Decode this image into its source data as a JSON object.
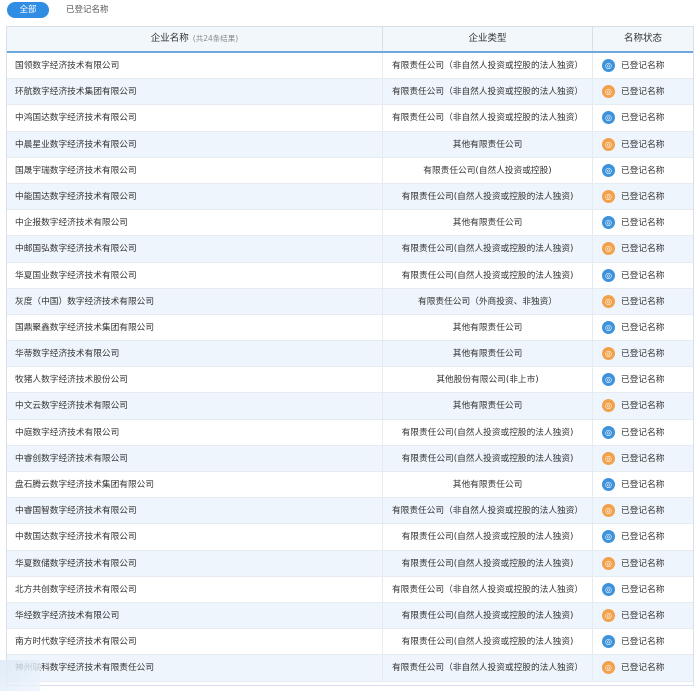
{
  "filter": {
    "tab_all": "全部",
    "tab_registered": "已登记名称"
  },
  "table": {
    "header": {
      "name": "企业名称",
      "count_note": "(共24条结果)",
      "type": "企业类型",
      "status": "名称状态"
    },
    "rows": [
      {
        "name": "国领数字经济技术有限公司",
        "type": "有限责任公司（非自然人投资或控股的法人独资）",
        "status": "已登记名称",
        "icon": "blue"
      },
      {
        "name": "环航数字经济技术集团有限公司",
        "type": "有限责任公司（非自然人投资或控股的法人独资）",
        "status": "已登记名称",
        "icon": "orange"
      },
      {
        "name": "中鸿国达数字经济技术有限公司",
        "type": "有限责任公司（非自然人投资或控股的法人独资）",
        "status": "已登记名称",
        "icon": "blue"
      },
      {
        "name": "中晨星业数字经济技术有限公司",
        "type": "其他有限责任公司",
        "status": "已登记名称",
        "icon": "orange"
      },
      {
        "name": "国晟宇瑞数字经济技术有限公司",
        "type": "有限责任公司(自然人投资或控股)",
        "status": "已登记名称",
        "icon": "blue"
      },
      {
        "name": "中能国达数字经济技术有限公司",
        "type": "有限责任公司(自然人投资或控股的法人独资)",
        "status": "已登记名称",
        "icon": "orange"
      },
      {
        "name": "中企报数字经济技术有限公司",
        "type": "其他有限责任公司",
        "status": "已登记名称",
        "icon": "blue"
      },
      {
        "name": "中邮国弘数字经济技术有限公司",
        "type": "有限责任公司(自然人投资或控股的法人独资)",
        "status": "已登记名称",
        "icon": "orange"
      },
      {
        "name": "华夏国业数字经济技术有限公司",
        "type": "有限责任公司(自然人投资或控股的法人独资)",
        "status": "已登记名称",
        "icon": "blue"
      },
      {
        "name": "灰度（中国）数字经济技术有限公司",
        "type": "有限责任公司（外商投资、非独资）",
        "status": "已登记名称",
        "icon": "orange"
      },
      {
        "name": "国鼎聚鑫数字经济技术集团有限公司",
        "type": "其他有限责任公司",
        "status": "已登记名称",
        "icon": "blue"
      },
      {
        "name": "华蒂数字经济技术有限公司",
        "type": "其他有限责任公司",
        "status": "已登记名称",
        "icon": "orange"
      },
      {
        "name": "牧猪人数字经济技术股份公司",
        "type": "其他股份有限公司(非上市)",
        "status": "已登记名称",
        "icon": "blue"
      },
      {
        "name": "中文云数字经济技术有限公司",
        "type": "其他有限责任公司",
        "status": "已登记名称",
        "icon": "orange"
      },
      {
        "name": "中庭数字经济技术有限公司",
        "type": "有限责任公司(自然人投资或控股的法人独资)",
        "status": "已登记名称",
        "icon": "blue"
      },
      {
        "name": "中睿创数字经济技术有限公司",
        "type": "有限责任公司(自然人投资或控股的法人独资)",
        "status": "已登记名称",
        "icon": "orange"
      },
      {
        "name": "盘石腾云数字经济技术集团有限公司",
        "type": "其他有限责任公司",
        "status": "已登记名称",
        "icon": "blue"
      },
      {
        "name": "中睿国智数字经济技术有限公司",
        "type": "有限责任公司（非自然人投资或控股的法人独资）",
        "status": "已登记名称",
        "icon": "orange"
      },
      {
        "name": "中数国达数字经济技术有限公司",
        "type": "有限责任公司(自然人投资或控股的法人独资)",
        "status": "已登记名称",
        "icon": "blue"
      },
      {
        "name": "华夏数储数字经济技术有限公司",
        "type": "有限责任公司(自然人投资或控股的法人独资)",
        "status": "已登记名称",
        "icon": "orange"
      },
      {
        "name": "北方共创数字经济技术有限公司",
        "type": "有限责任公司（非自然人投资或控股的法人独资）",
        "status": "已登记名称",
        "icon": "blue"
      },
      {
        "name": "华经数字经济技术有限公司",
        "type": "有限责任公司(自然人投资或控股的法人独资)",
        "status": "已登记名称",
        "icon": "orange"
      },
      {
        "name": "南方时代数字经济技术有限公司",
        "type": "有限责任公司(自然人投资或控股的法人独资)",
        "status": "已登记名称",
        "icon": "blue"
      },
      {
        "name": "神州联科数字经济技术有限责任公司",
        "type": "有限责任公司（非自然人投资或控股的法人独资）",
        "status": "已登记名称",
        "icon": "orange"
      }
    ]
  },
  "icons": {
    "status_icon": "registered-seal-icon"
  },
  "colors": {
    "accent": "#2f8de4",
    "icon_blue": "#3d92dc",
    "icon_orange": "#f2a14a",
    "header_border": "#6fa8dc"
  }
}
